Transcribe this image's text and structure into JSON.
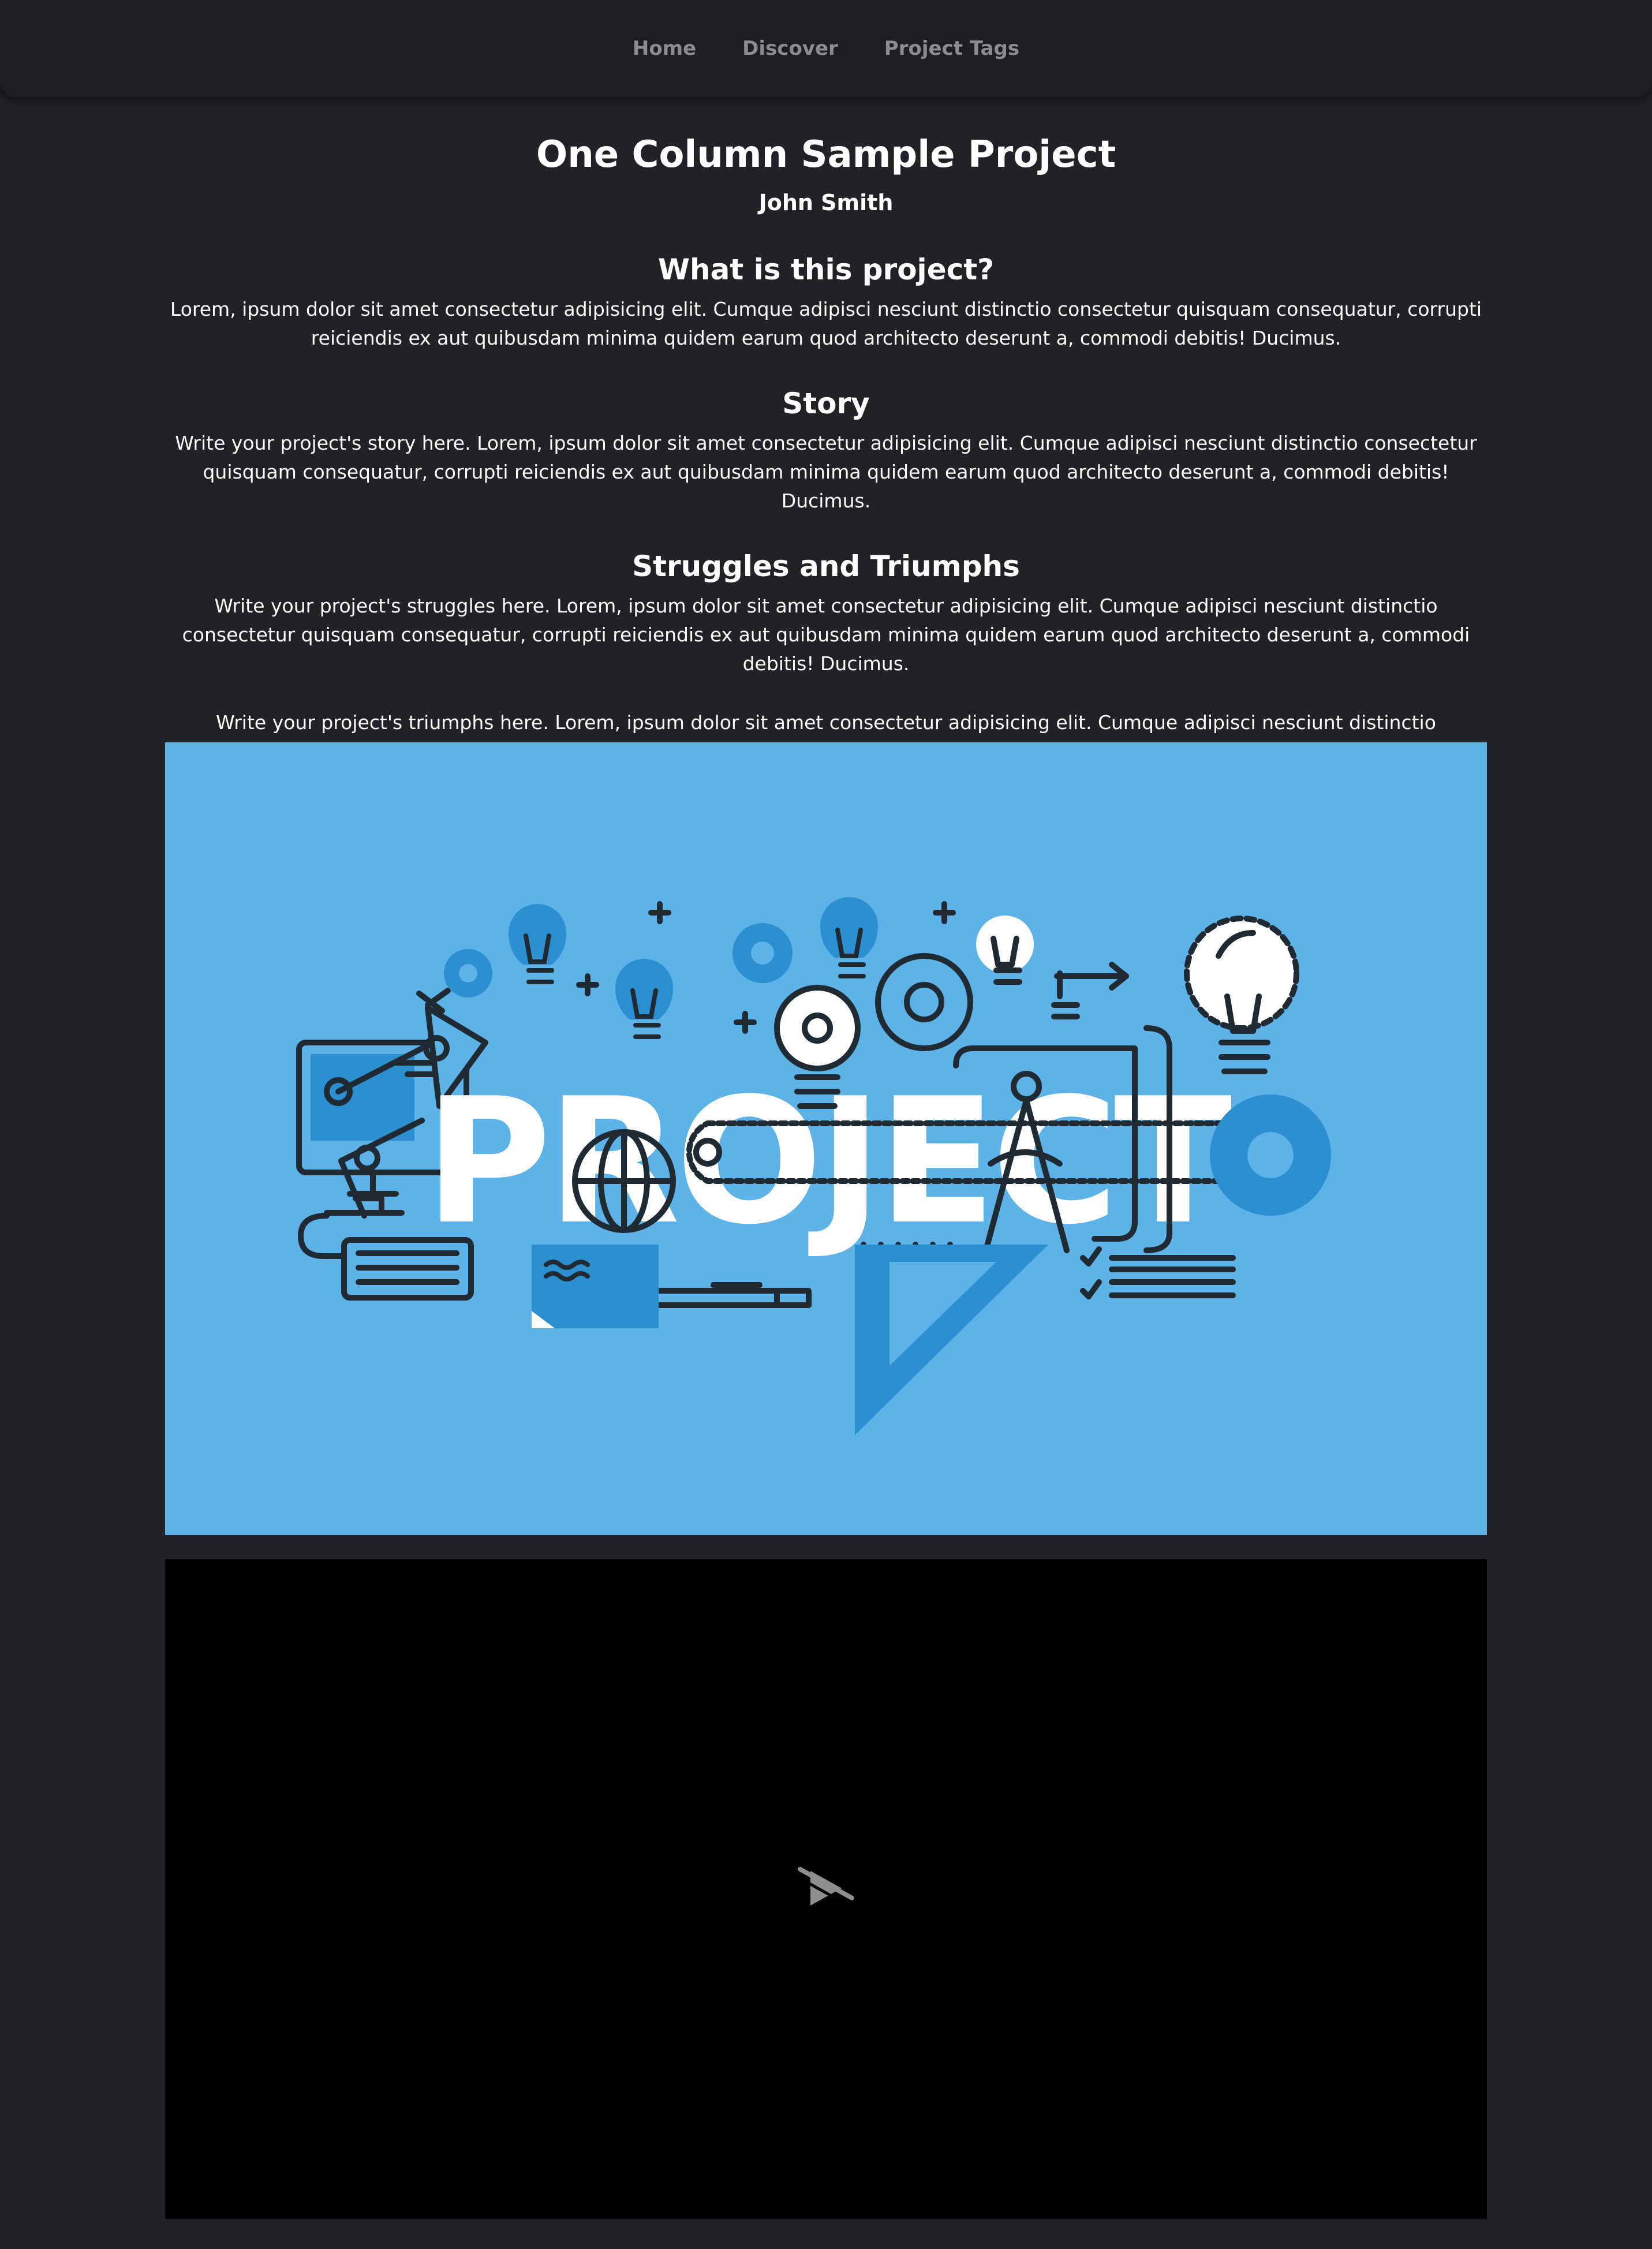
{
  "nav": {
    "links": [
      "Home",
      "Discover",
      "Project Tags"
    ]
  },
  "project": {
    "title": "One Column Sample Project",
    "author": "John Smith"
  },
  "sections": [
    {
      "heading": "What is this project?",
      "paragraphs": [
        "Lorem, ipsum dolor sit amet consectetur adipisicing elit. Cumque adipisci nesciunt distinctio consectetur quisquam consequatur, corrupti reiciendis ex aut quibusdam minima quidem earum quod architecto deserunt a, commodi debitis! Ducimus."
      ]
    },
    {
      "heading": "Story",
      "paragraphs": [
        "Write your project's story here. Lorem, ipsum dolor sit amet consectetur adipisicing elit. Cumque adipisci nesciunt distinctio consectetur quisquam consequatur, corrupti reiciendis ex aut quibusdam minima quidem earum quod architecto deserunt a, commodi debitis! Ducimus."
      ]
    },
    {
      "heading": "Struggles and Triumphs",
      "paragraphs": [
        "Write your project's struggles here. Lorem, ipsum dolor sit amet consectetur adipisicing elit. Cumque adipisci nesciunt distinctio consectetur quisquam consequatur, corrupti reiciendis ex aut quibusdam minima quidem earum quod architecto deserunt a, commodi debitis! Ducimus.",
        "Write your project's triumphs here. Lorem, ipsum dolor sit amet consectetur adipisicing elit. Cumque adipisci nesciunt distinctio consectetur quisquam consequatur, corrupti reiciendis ex aut quibusdam minima quidem earum quod architecto deserunt a, commodi debitis! Ducimus."
      ]
    }
  ],
  "hero": {
    "word": "PROJECT",
    "background": "#5db2e7",
    "accent": "#2b8fd0",
    "ink": "#1f2a33"
  },
  "video": {
    "icon": "play-disabled-icon"
  }
}
